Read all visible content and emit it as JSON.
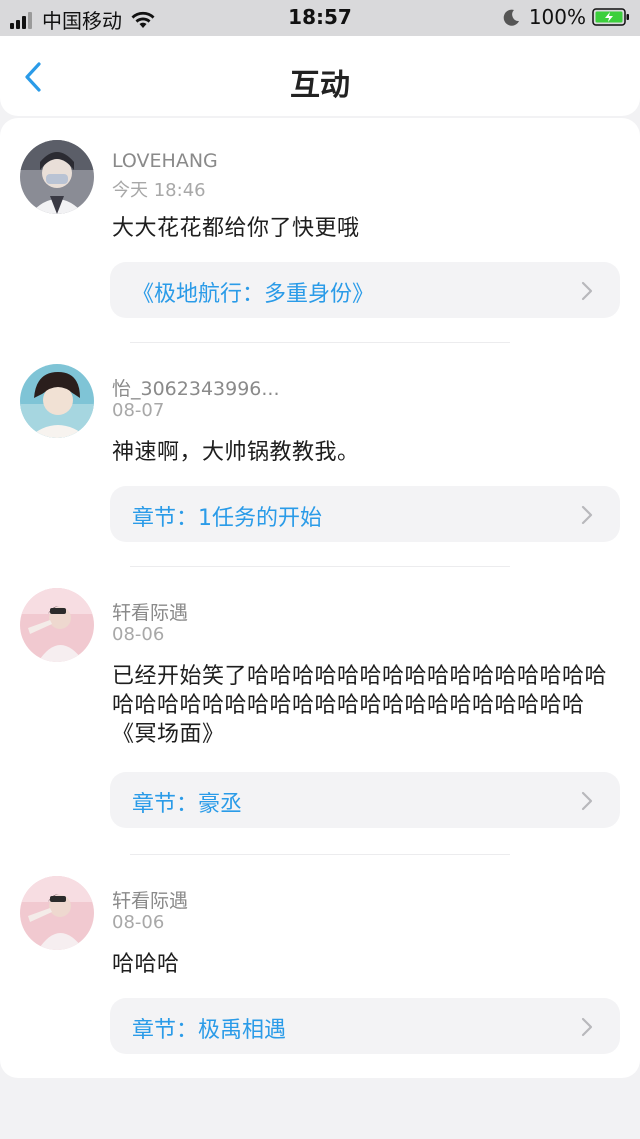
{
  "status_bar": {
    "carrier": "中国移动",
    "time": "18:57",
    "battery": "100%"
  },
  "nav": {
    "title": "互动"
  },
  "comments": [
    {
      "username": "LOVEHANG",
      "time": "今天 18:46",
      "text": "大大花花都给你了快更哦",
      "link": "《极地航行：多重身份》"
    },
    {
      "username": "怡_3062343996...",
      "time": "08-07",
      "text": "神速啊，大帅锅教教我。",
      "link": "章节：1任务的开始"
    },
    {
      "username": "轩看际遇",
      "time": "08-06",
      "text": "已经开始笑了哈哈哈哈哈哈哈哈哈哈哈哈哈哈哈哈哈哈哈哈哈哈哈哈哈哈哈哈哈哈哈哈哈哈哈哈哈《冥场面》",
      "link": "章节：豪丞"
    },
    {
      "username": "轩看际遇",
      "time": "08-06",
      "text": "哈哈哈",
      "link": "章节：极禹相遇"
    }
  ],
  "colors": {
    "accent": "#2a9be8",
    "username": "#8a8a8a",
    "background": "#f2f2f4"
  }
}
